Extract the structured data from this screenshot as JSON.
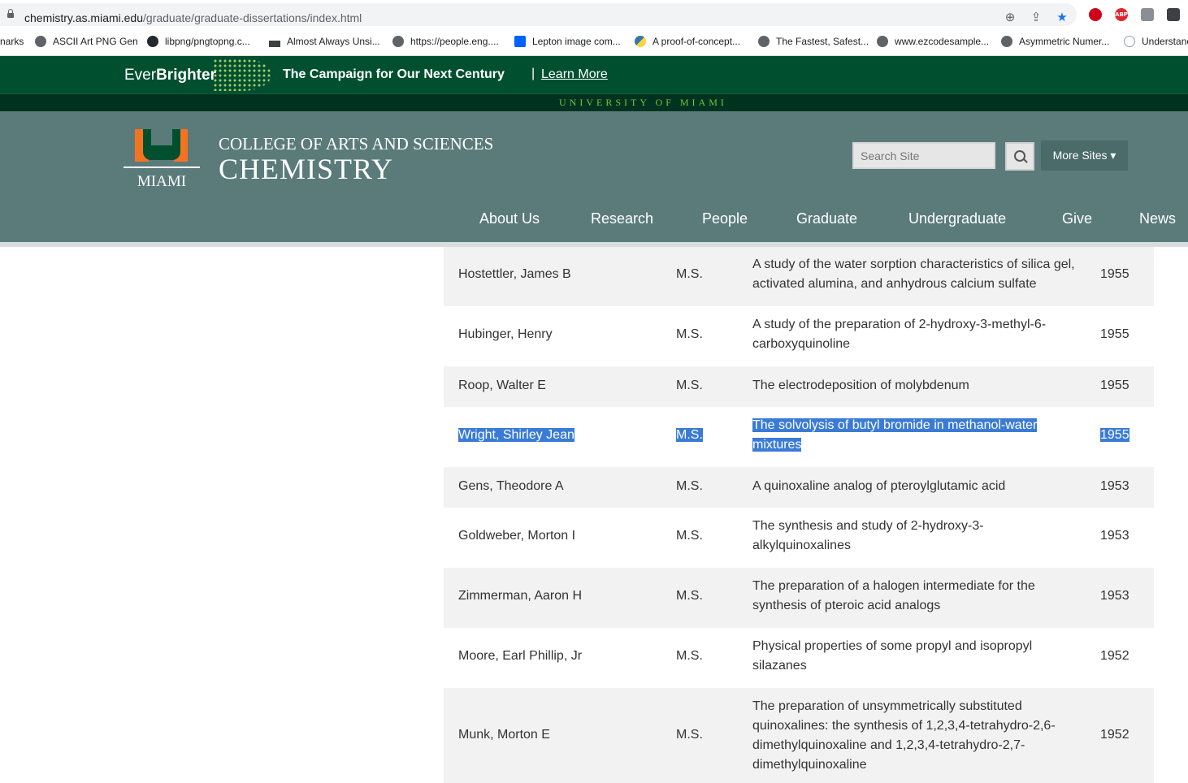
{
  "browser": {
    "url_host": "chemistry.as.miami.edu",
    "url_path": "/graduate/graduate-dissertations/index.html",
    "icons": [
      "zoom-icon",
      "share-icon",
      "star-icon"
    ],
    "extensions": [
      "ublock-icon",
      "abp-icon",
      "extension-icon",
      "extension-icon-2"
    ],
    "abp_label": "ABP"
  },
  "bookmarks": [
    {
      "label": "narks"
    },
    {
      "label": "ASCII Art PNG Gen"
    },
    {
      "label": "libpng/pngtopng.c..."
    },
    {
      "label": "Almost Always Unsi..."
    },
    {
      "label": "https://people.eng...."
    },
    {
      "label": "Lepton image com..."
    },
    {
      "label": "A proof-of-concept..."
    },
    {
      "label": "The Fastest, Safest..."
    },
    {
      "label": "www.ezcodesample..."
    },
    {
      "label": "Asymmetric Numer..."
    },
    {
      "label": "Understanc"
    }
  ],
  "campaign": {
    "logo_ever": "Ever",
    "logo_brighter": "Brighter",
    "text": "The Campaign for Our Next Century",
    "separator": "|",
    "link": "Learn More",
    "university": "UNIVERSITY OF MIAMI"
  },
  "header": {
    "logo_text": "MIAMI",
    "college": "COLLEGE OF ARTS AND SCIENCES",
    "department": "CHEMISTRY",
    "search_placeholder": "Search Site",
    "more_sites": "More Sites ▾"
  },
  "nav": [
    "About Us",
    "Research",
    "People",
    "Graduate",
    "Undergraduate",
    "Give",
    "News"
  ],
  "dissertations": [
    {
      "name": "Hostettler, James B",
      "degree": "M.S.",
      "title": "A study of the water sorption characteristics of silica gel, activated alumina, and anhydrous calcium sulfate",
      "year": "1955"
    },
    {
      "name": "Hubinger, Henry",
      "degree": "M.S.",
      "title": "A study of the preparation of 2-hydroxy-3-methyl-6-carboxyquinoline",
      "year": "1955"
    },
    {
      "name": "Roop, Walter E",
      "degree": "M.S.",
      "title": "The electrodeposition of molybdenum",
      "year": "1955"
    },
    {
      "name": "Wright, Shirley Jean",
      "degree": "M.S.",
      "title": "The solvolysis of butyl bromide in methanol-water mixtures",
      "year": "1955",
      "selected": true
    },
    {
      "name": "Gens, Theodore A",
      "degree": "M.S.",
      "title": "A quinoxaline analog of pteroylglutamic acid",
      "year": "1953"
    },
    {
      "name": "Goldweber, Morton I",
      "degree": "M.S.",
      "title": "The synthesis and study of 2-hydroxy-3-alkylquinoxalines",
      "year": "1953"
    },
    {
      "name": "Zimmerman, Aaron H",
      "degree": "M.S.",
      "title": "The preparation of a halogen intermediate for the synthesis of pteroic acid analogs",
      "year": "1953"
    },
    {
      "name": "Moore, Earl Phillip, Jr",
      "degree": "M.S.",
      "title": "Physical properties of some propyl and isopropyl silazanes",
      "year": "1952"
    },
    {
      "name": "Munk, Morton E",
      "degree": "M.S.",
      "title": "The preparation of unsymmetrically substituted quinoxalines: the synthesis of 1,2,3,4-tetrahydro-2,6-dimethylquinoxaline and 1,2,3,4-tetrahydro-2,7-dimethylquinoxaline",
      "year": "1952"
    }
  ],
  "colors": {
    "campaign_green": "#005030",
    "header_teal": "#5b7b7b",
    "miami_orange": "#f47321",
    "selection_blue": "#3a7bd5"
  }
}
